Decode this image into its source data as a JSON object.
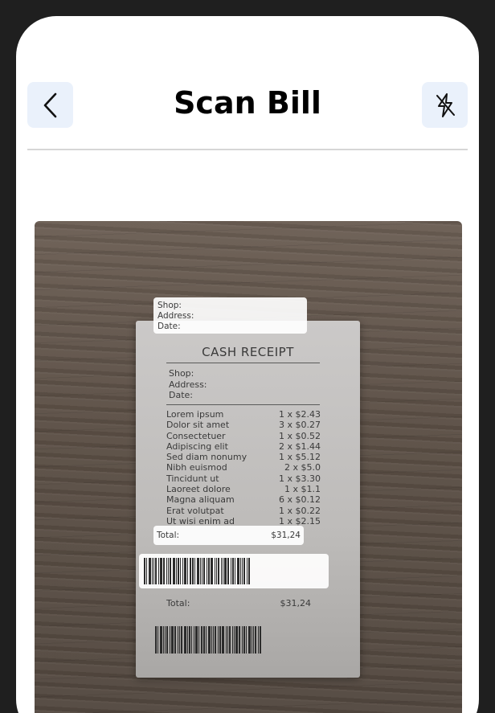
{
  "header": {
    "title": "Scan Bill",
    "back_icon": "chevron-left-icon",
    "flash_icon": "flash-off-icon"
  },
  "receipt": {
    "title": "CASH RECEIPT",
    "meta": [
      "Shop:",
      "Address:",
      "Date:"
    ],
    "items": [
      {
        "name": "Lorem ipsum",
        "price": "1 x $2.43"
      },
      {
        "name": "Dolor sit amet",
        "price": "3 x $0.27"
      },
      {
        "name": "Consectetuer",
        "price": "1 x $0.52"
      },
      {
        "name": "Adipiscing elit",
        "price": "2 x $1.44"
      },
      {
        "name": "Sed diam nonumy",
        "price": "1 x $5.12"
      },
      {
        "name": "Nibh euismod",
        "price": "2 x $5.0"
      },
      {
        "name": "Tincidunt ut",
        "price": "1 x $3.30"
      },
      {
        "name": "Laoreet dolore",
        "price": "1 x $1.1"
      },
      {
        "name": "Magna aliquam",
        "price": "6 x $0.12"
      },
      {
        "name": "Erat volutpat",
        "price": "1 x $0.22"
      },
      {
        "name": "Ut wisi enim ad",
        "price": "1 x $2.15"
      }
    ],
    "total_label": "Total:",
    "total_value": "$31,24"
  },
  "overlays": {
    "shop_lines": [
      "Shop:",
      "Address:",
      "Date:"
    ],
    "total_label": "Total:",
    "total_value": "$31,24"
  },
  "colors": {
    "accent_bg": "#eaf1fb",
    "frame": "#1f1f1f"
  }
}
